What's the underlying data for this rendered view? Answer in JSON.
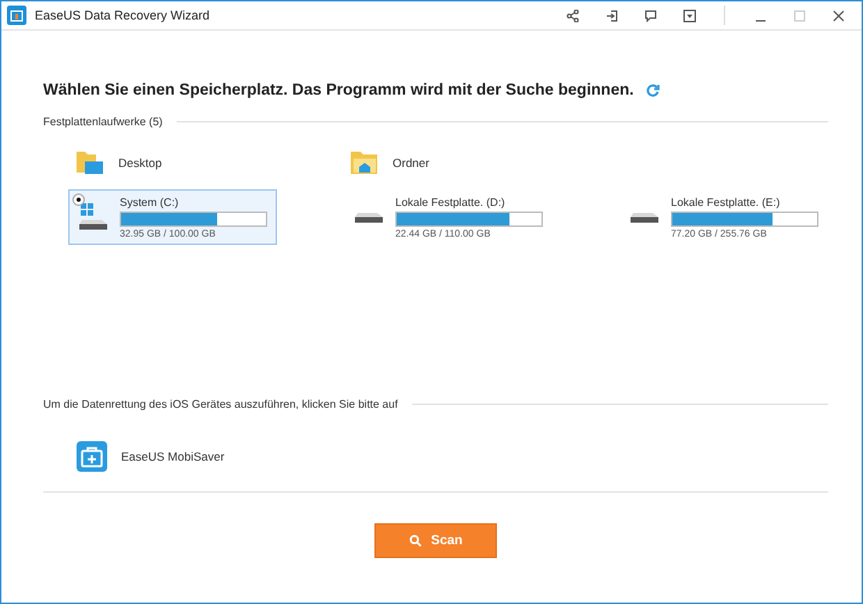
{
  "window": {
    "title": "EaseUS Data Recovery Wizard"
  },
  "heading": "Wählen Sie einen Speicherplatz. Das Programm wird mit der Suche beginnen.",
  "drives_section": {
    "label": "Festplattenlaufwerke (5)",
    "locations": [
      {
        "name": "Desktop",
        "kind": "desktop"
      },
      {
        "name": "Ordner",
        "kind": "folder"
      }
    ],
    "drives": [
      {
        "name": "System (C:)",
        "usage": "32.95 GB / 100.00 GB",
        "level": 0.66,
        "selected": true,
        "kind": "system"
      },
      {
        "name": "Lokale Festplatte. (D:)",
        "usage": "22.44 GB / 110.00 GB",
        "level": 0.78,
        "selected": false,
        "kind": "disk"
      },
      {
        "name": "Lokale Festplatte. (E:)",
        "usage": "77.20 GB / 255.76 GB",
        "level": 0.69,
        "selected": false,
        "kind": "disk"
      }
    ]
  },
  "ios_section": {
    "label": "Um die Datenrettung des iOS Gerätes auszuführen, klicken Sie bitte auf",
    "app": "EaseUS MobiSaver"
  },
  "scan_button": "Scan"
}
